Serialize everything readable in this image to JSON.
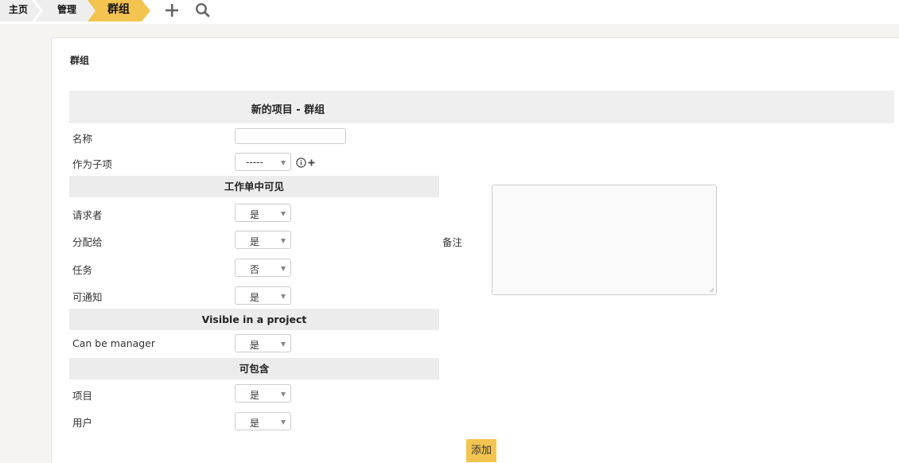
{
  "breadcrumb": {
    "home": "主页",
    "manage": "管理",
    "current": "群组"
  },
  "toolbar": {
    "add_icon": "plus-icon",
    "search_icon": "search-icon"
  },
  "panel": {
    "title": "群组"
  },
  "form": {
    "header": "新的项目 - 群组",
    "name_label": "名称",
    "name_value": "",
    "parent_label": "作为子项",
    "parent_value": "-----",
    "sections": {
      "visible_in_ticket": "工作单中可见",
      "visible_in_project": "Visible in a project",
      "can_contain": "可包含"
    },
    "fields": {
      "requester": {
        "label": "请求者",
        "value": "是"
      },
      "assignee": {
        "label": "分配给",
        "value": "是"
      },
      "task": {
        "label": "任务",
        "value": "否"
      },
      "notify": {
        "label": "可通知",
        "value": "是"
      },
      "can_be_manager": {
        "label": "Can be manager",
        "value": "是"
      },
      "items": {
        "label": "项目",
        "value": "是"
      },
      "users": {
        "label": "用户",
        "value": "是"
      }
    },
    "notes_label": "备注",
    "notes_value": "",
    "submit_label": "添加"
  },
  "colors": {
    "accent": "#f4c451",
    "breadcrumb_bg": "#eeeeee",
    "section_bg": "#ececec",
    "page_bg": "#f5f4f0"
  }
}
